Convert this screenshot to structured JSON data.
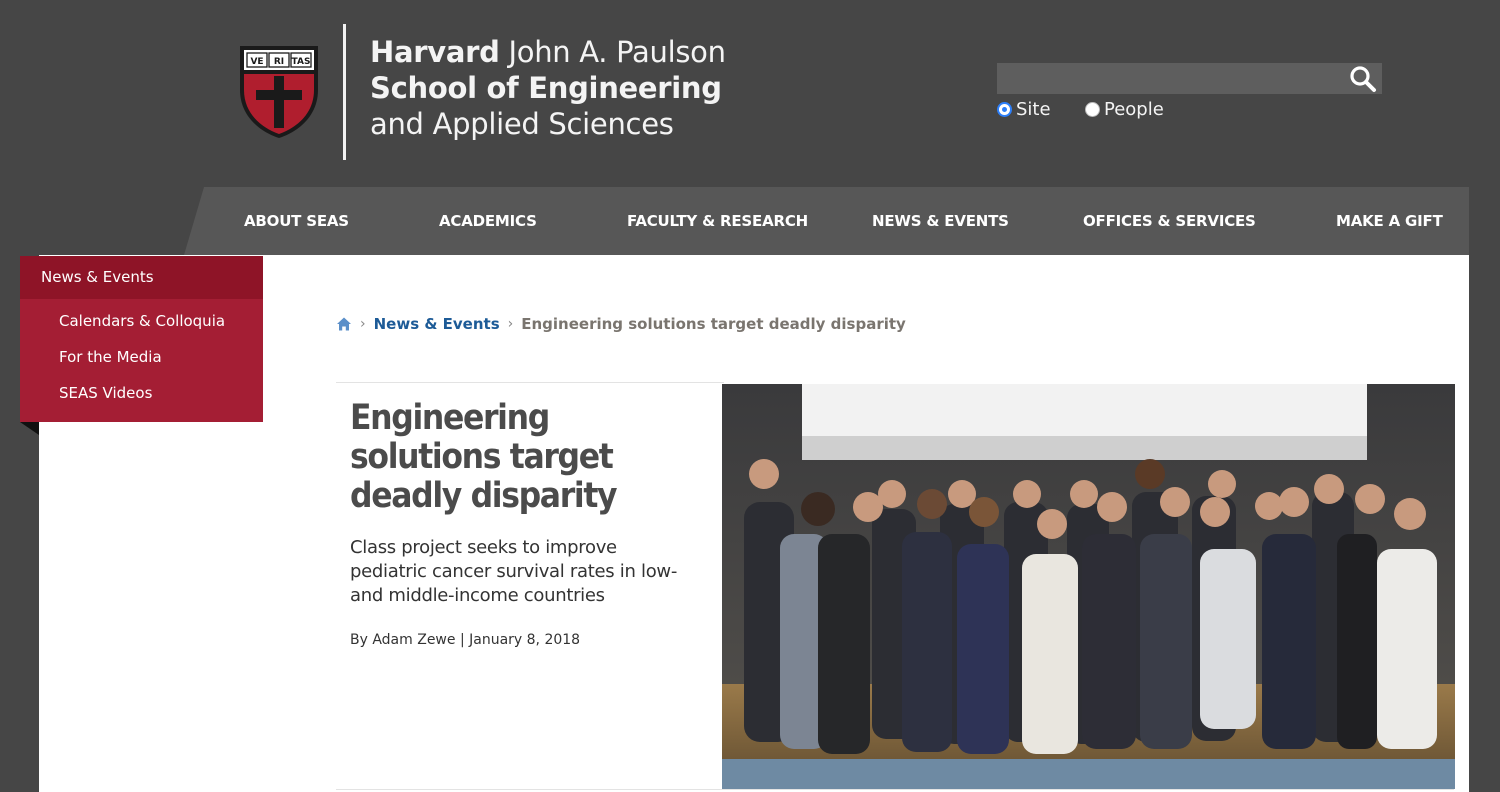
{
  "header": {
    "school_line1_bold": "Harvard",
    "school_line1_rest": " John A. Paulson",
    "school_line2": "School of Engineering",
    "school_line3": "and Applied Sciences",
    "shield_text": [
      "VE",
      "RI",
      "TAS"
    ],
    "search": {
      "value": "",
      "placeholder": ""
    },
    "search_scope": [
      {
        "label": "Site",
        "selected": true
      },
      {
        "label": "People",
        "selected": false
      }
    ]
  },
  "nav": {
    "items": [
      {
        "label": "ABOUT SEAS"
      },
      {
        "label": "ACADEMICS"
      },
      {
        "label": "FACULTY & RESEARCH"
      },
      {
        "label": "NEWS & EVENTS"
      },
      {
        "label": "OFFICES & SERVICES"
      },
      {
        "label": "MAKE A GIFT"
      }
    ]
  },
  "subnav": {
    "heading": "News & Events",
    "items": [
      {
        "label": "Calendars & Colloquia"
      },
      {
        "label": "For the Media"
      },
      {
        "label": "SEAS Videos"
      }
    ]
  },
  "breadcrumb": {
    "home_icon": "home-icon",
    "section": "News & Events",
    "current": "Engineering solutions target deadly disparity"
  },
  "article": {
    "title": "Engineering solutions target deadly disparity",
    "dek": "Class project seeks to improve pediatric cancer survival rates in low- and middle-income countries",
    "byline": "By Adam Zewe | January 8, 2018"
  },
  "colors": {
    "header_bg": "#464646",
    "nav_bg": "#575757",
    "crimson": "#a41e34",
    "crimson_dark": "#8e1427",
    "link_blue": "#1d5b97"
  }
}
